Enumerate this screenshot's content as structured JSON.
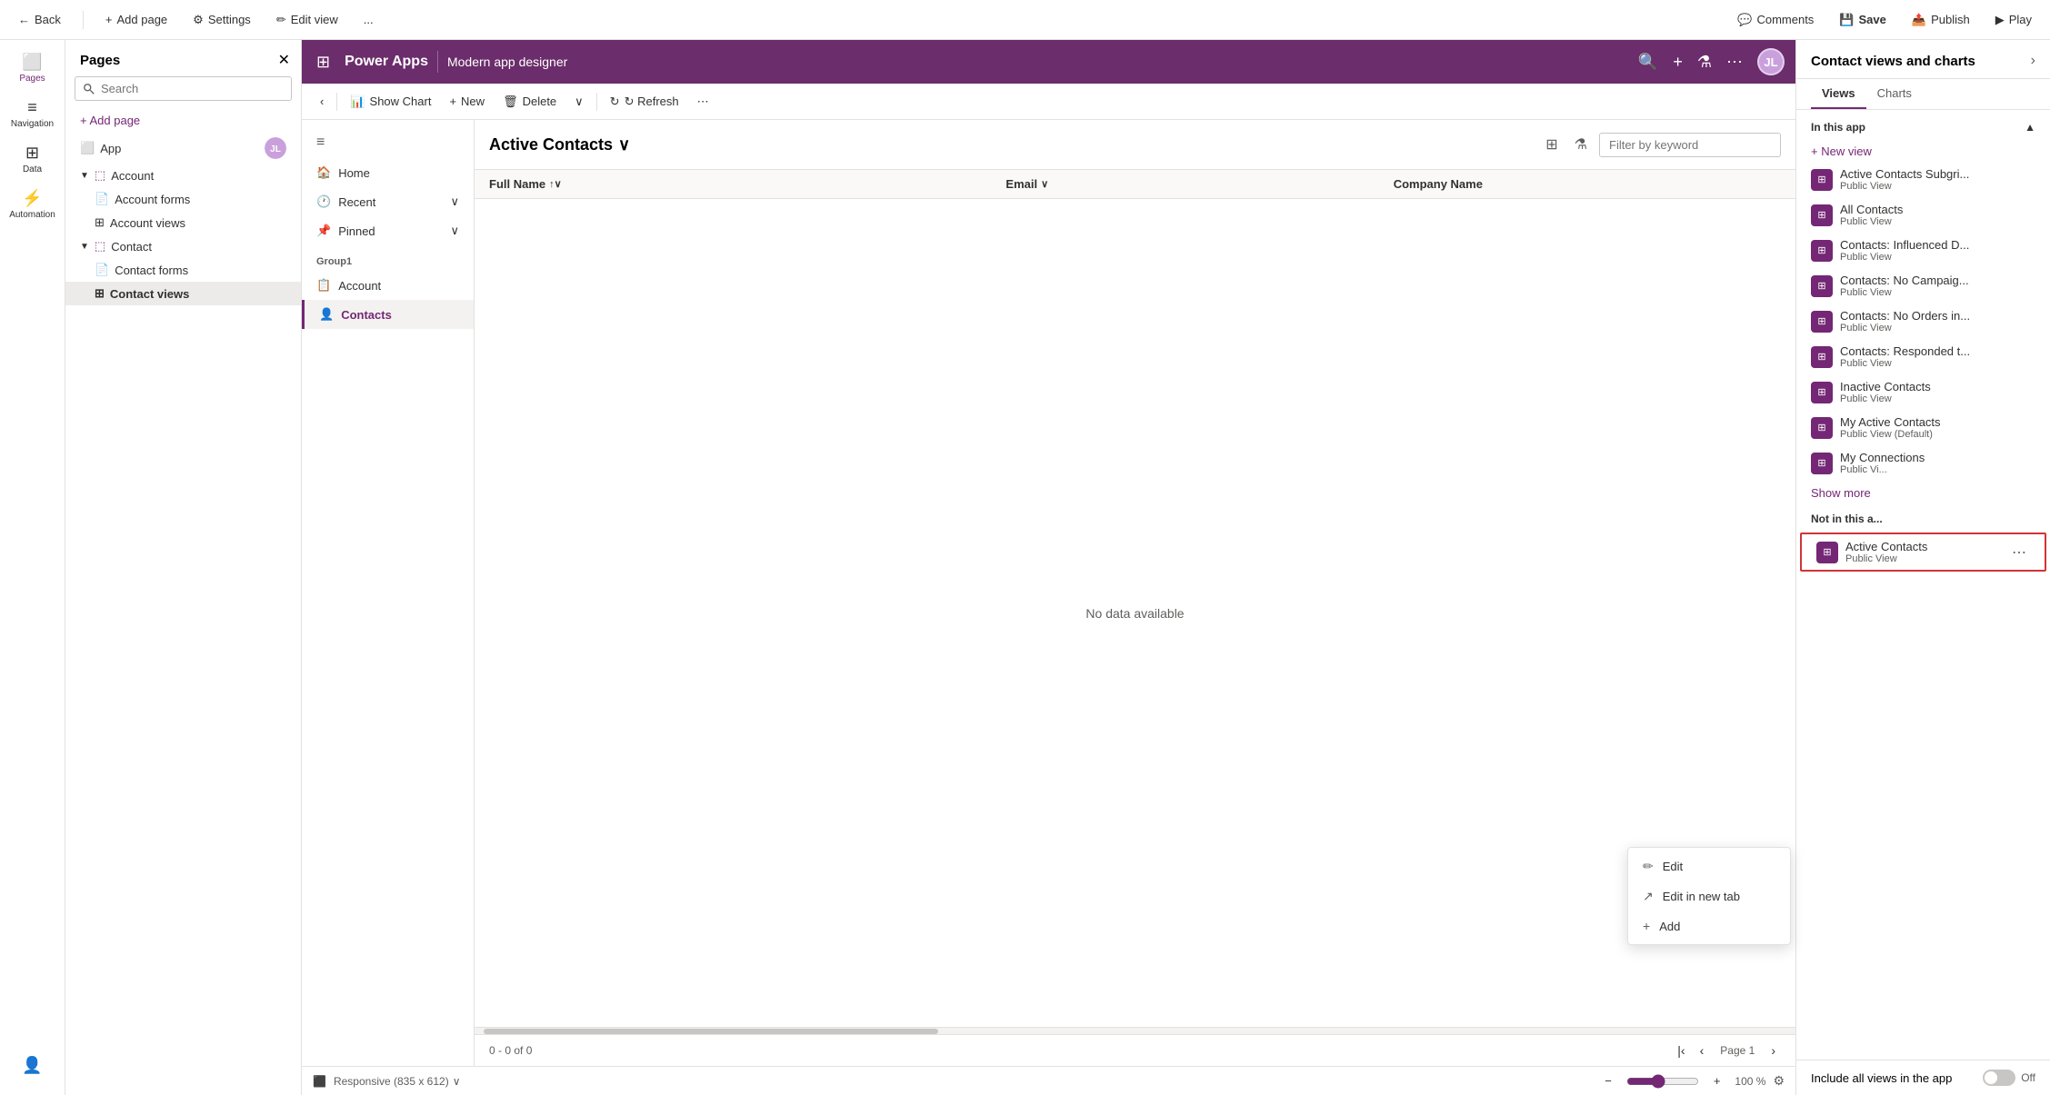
{
  "topbar": {
    "back_label": "Back",
    "add_page_label": "Add page",
    "settings_label": "Settings",
    "edit_view_label": "Edit view",
    "more_label": "...",
    "comments_label": "Comments",
    "save_label": "Save",
    "publish_label": "Publish",
    "play_label": "Play"
  },
  "left_sidebar": {
    "items": [
      {
        "id": "pages",
        "label": "Pages",
        "icon": "⬜"
      },
      {
        "id": "navigation",
        "label": "Navigation",
        "icon": "≡"
      },
      {
        "id": "data",
        "label": "Data",
        "icon": "⊞"
      },
      {
        "id": "automation",
        "label": "Automation",
        "icon": "⚡"
      }
    ]
  },
  "pages_panel": {
    "title": "Pages",
    "search_placeholder": "Search",
    "add_page_label": "+ Add page",
    "tree": [
      {
        "id": "app",
        "label": "App",
        "icon": "⊡",
        "badge": true
      },
      {
        "id": "account",
        "label": "Account",
        "icon": "▼",
        "expanded": true
      },
      {
        "id": "account-forms",
        "label": "Account forms",
        "icon": "📄",
        "indent": 1
      },
      {
        "id": "account-views",
        "label": "Account views",
        "icon": "⊞",
        "indent": 1
      },
      {
        "id": "contact",
        "label": "Contact",
        "icon": "▼",
        "expanded": true
      },
      {
        "id": "contact-forms",
        "label": "Contact forms",
        "icon": "📄",
        "indent": 1
      },
      {
        "id": "contact-views",
        "label": "Contact views",
        "icon": "⊞",
        "indent": 1,
        "active": true
      }
    ]
  },
  "pa_header": {
    "grid_icon": "⊞",
    "brand": "Power Apps",
    "divider": true,
    "app_name": "Modern app designer",
    "avatar_initials": "JL"
  },
  "canvas_toolbar": {
    "back_label": "‹",
    "show_chart_label": "Show Chart",
    "new_label": "New",
    "delete_label": "Delete",
    "dropdown_label": "›",
    "refresh_label": "↻ Refresh",
    "more_label": "⋯"
  },
  "canvas": {
    "nav": {
      "hamburger": "≡",
      "items": [
        {
          "id": "home",
          "label": "Home",
          "icon": "🏠"
        },
        {
          "id": "recent",
          "label": "Recent",
          "icon": "🕐",
          "has_chevron": true
        },
        {
          "id": "pinned",
          "label": "Pinned",
          "icon": "📌",
          "has_chevron": true
        }
      ],
      "group_label": "Group1",
      "group_items": [
        {
          "id": "account",
          "label": "Account",
          "icon": "📋"
        },
        {
          "id": "contacts",
          "label": "Contacts",
          "icon": "👤",
          "active": true
        }
      ]
    },
    "title": "Active Contacts",
    "title_chevron": "∨",
    "filter_placeholder": "Filter by keyword",
    "columns": [
      {
        "id": "full-name",
        "label": "Full Name",
        "sortable": true
      },
      {
        "id": "email",
        "label": "Email",
        "sortable": true
      },
      {
        "id": "company",
        "label": "Company Name",
        "sortable": false
      }
    ],
    "empty_message": "No data available",
    "pagination": {
      "record_range": "0 - 0 of 0",
      "page_label": "Page 1"
    }
  },
  "bottom_bar": {
    "responsive_label": "Responsive (835 x 612)",
    "zoom_minus": "−",
    "zoom_value": "100 %",
    "zoom_plus": "+"
  },
  "right_panel": {
    "title": "Contact views and charts",
    "tabs": [
      {
        "id": "views",
        "label": "Views",
        "active": true
      },
      {
        "id": "charts",
        "label": "Charts"
      }
    ],
    "in_this_app_label": "In this app",
    "new_view_label": "+ New view",
    "views_in_app": [
      {
        "id": "active-contacts-subgri",
        "name": "Active Contacts Subgri...",
        "type": "Public View"
      },
      {
        "id": "all-contacts",
        "name": "All Contacts",
        "type": "Public View"
      },
      {
        "id": "contacts-influenced",
        "name": "Contacts: Influenced D...",
        "type": "Public View"
      },
      {
        "id": "contacts-no-campaign",
        "name": "Contacts: No Campaig...",
        "type": "Public View"
      },
      {
        "id": "contacts-no-orders",
        "name": "Contacts: No Orders in...",
        "type": "Public View"
      },
      {
        "id": "contacts-responded",
        "name": "Contacts: Responded t...",
        "type": "Public View"
      },
      {
        "id": "inactive-contacts",
        "name": "Inactive Contacts",
        "type": "Public View"
      },
      {
        "id": "my-active-contacts",
        "name": "My Active Contacts",
        "type": "Public View (Default)"
      },
      {
        "id": "my-connections",
        "name": "My Connections",
        "type": "Public Vi..."
      }
    ],
    "show_more_label": "Show more",
    "not_in_app_label": "Not in this a...",
    "views_not_in_app": [
      {
        "id": "active-contacts",
        "name": "Active Contacts",
        "type": "Public View",
        "highlighted": true
      }
    ],
    "footer": {
      "include_label": "Include all views in the app",
      "toggle_state": false,
      "off_label": "Off"
    }
  },
  "context_menu": {
    "items": [
      {
        "id": "edit",
        "label": "Edit",
        "icon": "✏️"
      },
      {
        "id": "edit-new-tab",
        "label": "Edit in new tab",
        "icon": "↗"
      },
      {
        "id": "add",
        "label": "Add",
        "icon": "+"
      }
    ]
  }
}
